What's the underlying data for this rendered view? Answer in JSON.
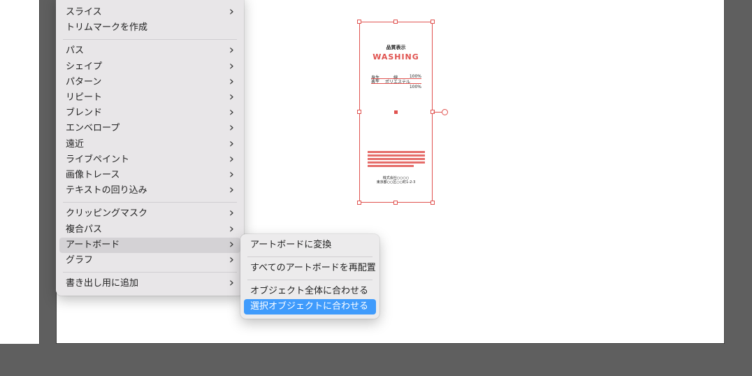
{
  "main_menu": {
    "groups": [
      [
        {
          "label": "スライス",
          "submenu": true
        },
        {
          "label": "トリムマークを作成",
          "submenu": false
        }
      ],
      [
        {
          "label": "パス",
          "submenu": true
        },
        {
          "label": "シェイプ",
          "submenu": true
        },
        {
          "label": "パターン",
          "submenu": true
        },
        {
          "label": "リピート",
          "submenu": true
        },
        {
          "label": "ブレンド",
          "submenu": true
        },
        {
          "label": "エンベロープ",
          "submenu": true
        },
        {
          "label": "遠近",
          "submenu": true
        },
        {
          "label": "ライブペイント",
          "submenu": true
        },
        {
          "label": "画像トレース",
          "submenu": true
        },
        {
          "label": "テキストの回り込み",
          "submenu": true
        }
      ],
      [
        {
          "label": "クリッピングマスク",
          "submenu": true
        },
        {
          "label": "複合パス",
          "submenu": true
        },
        {
          "label": "アートボード",
          "submenu": true,
          "hovered": true
        },
        {
          "label": "グラフ",
          "submenu": true
        }
      ],
      [
        {
          "label": "書き出し用に追加",
          "submenu": true
        }
      ]
    ]
  },
  "artboard_submenu": {
    "groups": [
      [
        {
          "label": "アートボードに変換"
        }
      ],
      [
        {
          "label": "すべてのアートボードを再配置"
        }
      ],
      [
        {
          "label": "オブジェクト全体に合わせる"
        },
        {
          "label": "選択オブジェクトに合わせる",
          "active": true
        }
      ]
    ]
  },
  "artwork": {
    "title": "品質表示",
    "logo_text": "WASHING",
    "row1_left": "身生",
    "row1_mid": "綿",
    "row1_right": "100%",
    "row2_left": "表生",
    "row2_mid": "ポリエステル",
    "row2_right": "100%",
    "footer_line1": "株式会社○○○○",
    "footer_line2": "東京都○○区○○町1-2-3"
  },
  "colors": {
    "selection": "#e0524f",
    "menu_active": "#3f9bfc",
    "menu_hover": "#d4d2d5",
    "workspace": "#5f5f5f"
  },
  "icons": {
    "submenu_arrow": "chevron-right-icon"
  }
}
